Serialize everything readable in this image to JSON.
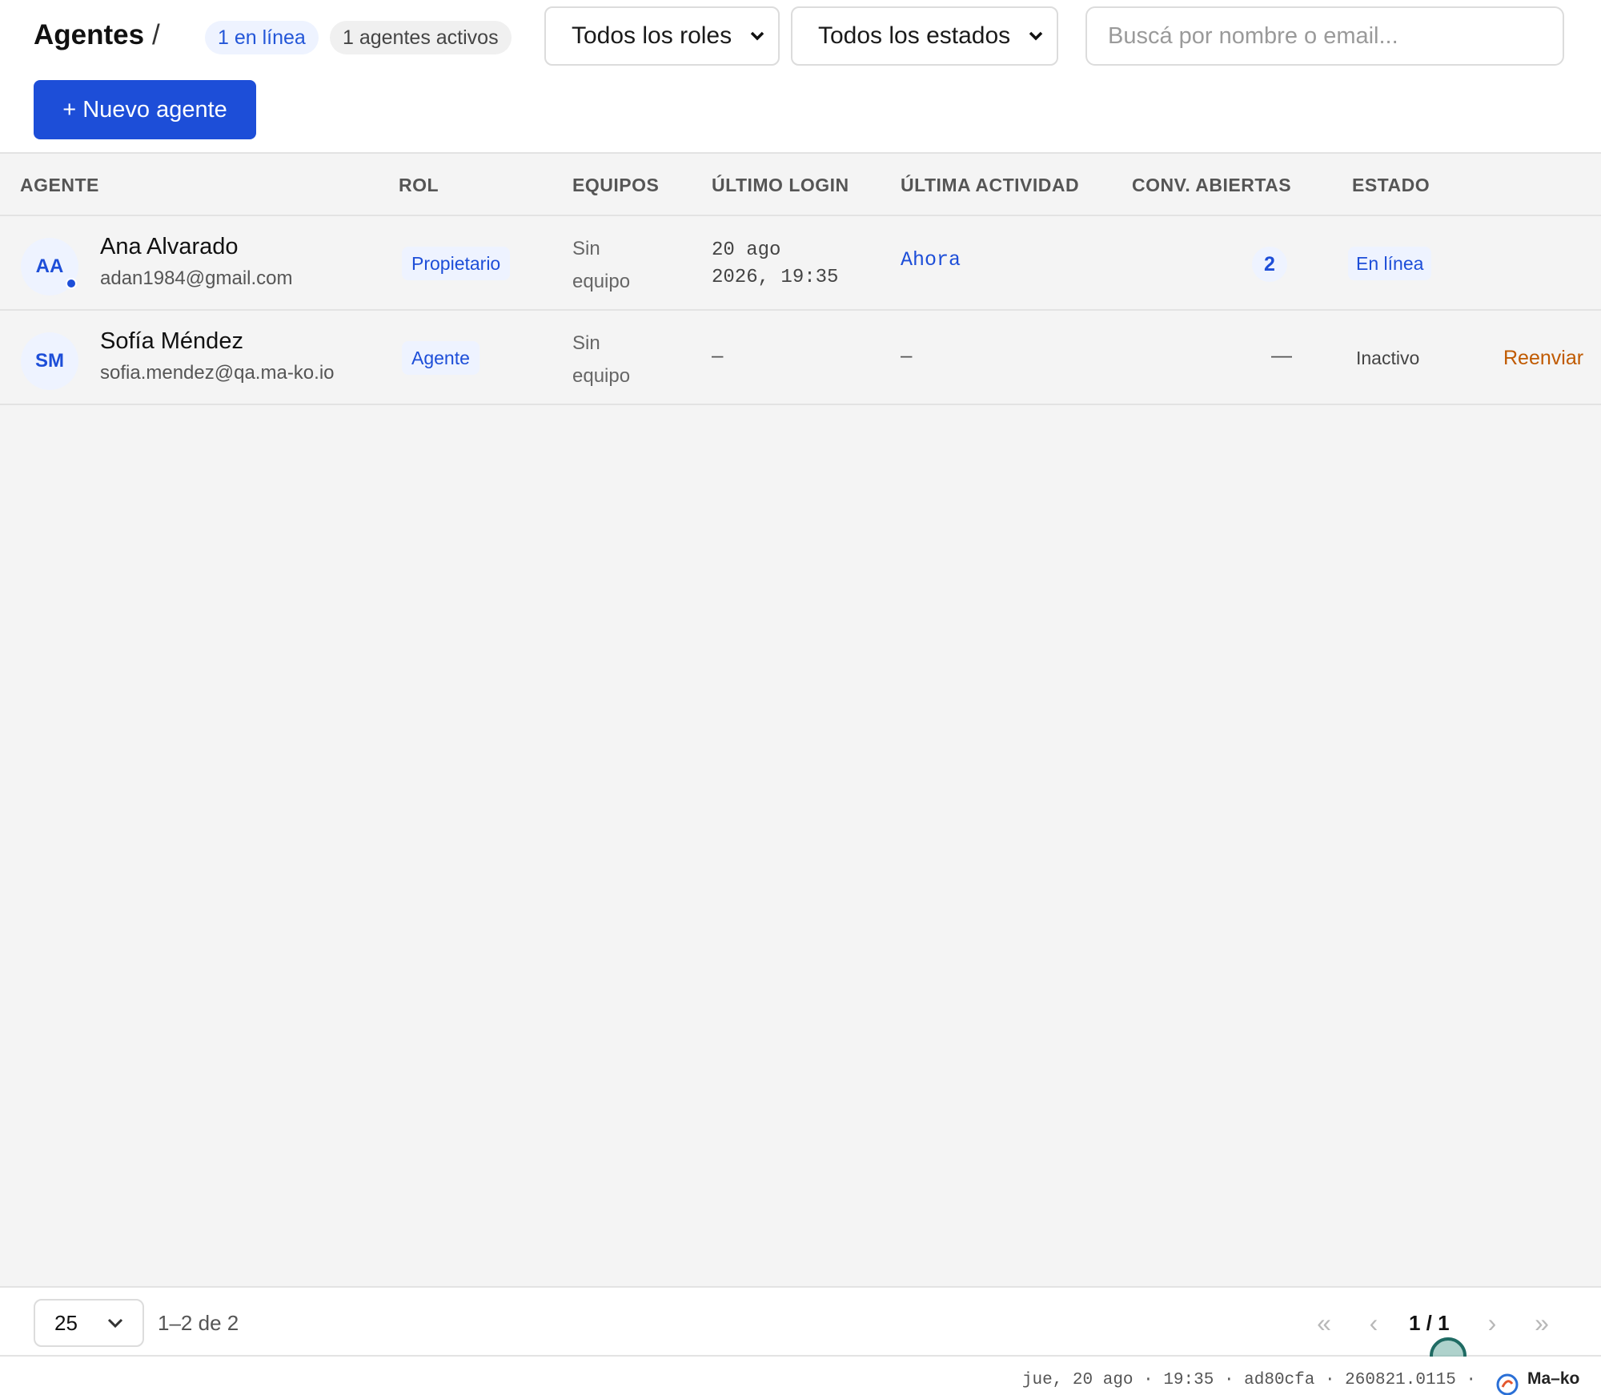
{
  "header": {
    "title": "Agentes",
    "separator": "/",
    "online_badge": "1 en línea",
    "active_badge": "1 agentes activos",
    "roles_filter": "Todos los roles",
    "states_filter": "Todos los estados",
    "search_placeholder": "Buscá por nombre o email...",
    "new_agent_label": "+ Nuevo agente"
  },
  "table": {
    "columns": [
      "AGENTE",
      "ROL",
      "EQUIPOS",
      "ÚLTIMO LOGIN",
      "ÚLTIMA ACTIVIDAD",
      "CONV. ABIERTAS",
      "ESTADO"
    ],
    "rows": [
      {
        "initials": "AA",
        "name": "Ana Alvarado",
        "email": "adan1984@gmail.com",
        "role": "Propietario",
        "teams_line1": "Sin",
        "teams_line2": "equipo",
        "last_login_line1": "20 ago",
        "last_login_line2": "2026, 19:35",
        "last_activity": "Ahora",
        "open_conversations": "2",
        "status": "En línea"
      },
      {
        "initials": "SM",
        "name": "Sofía Méndez",
        "email": "sofia.mendez@qa.ma-ko.io",
        "role": "Agente",
        "teams_line1": "Sin",
        "teams_line2": "equipo",
        "last_login": "–",
        "last_activity": "–",
        "open_conversations": "—",
        "status": "Inactivo",
        "action": "Reenviar"
      }
    ]
  },
  "pagination": {
    "page_size": "25",
    "range": "1–2 de 2",
    "first": "«",
    "prev": "‹",
    "current": "1 / 1",
    "next": "›",
    "last": "»"
  },
  "statusbar": {
    "info": "jue, 20 ago · 19:35 · ad80cfa · 260821.0115 ·",
    "brand": "Ma–ko"
  },
  "colors": {
    "accent": "#1d4ed8",
    "accent_soft": "#eef3ff",
    "resend": "#c05a00",
    "background": "#f4f4f4"
  },
  "icons": {
    "chevron": "chevron-down-icon",
    "online": "online-dot-icon",
    "brand": "brand-logo-icon"
  }
}
